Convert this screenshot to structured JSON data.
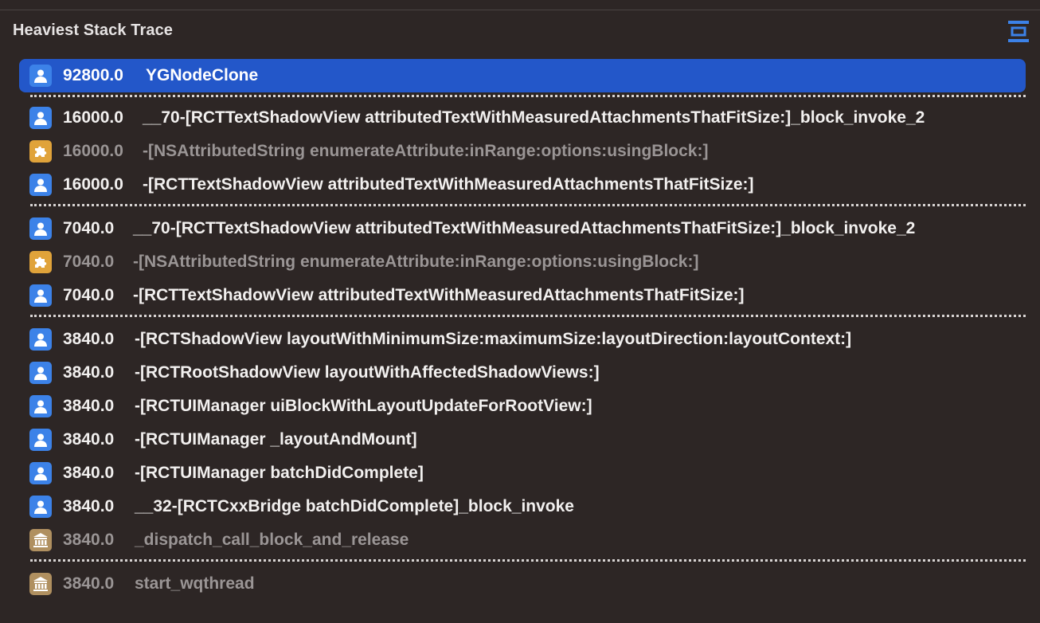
{
  "header": {
    "title": "Heaviest Stack Trace",
    "collapse_icon": "collapse-all-icon",
    "accent_color": "#3c82e8"
  },
  "colors": {
    "selection": "#2357c9",
    "user_icon": "#3c82e8",
    "framework_icon": "#e0a33a",
    "system_icon": "#b09060"
  },
  "frames": [
    {
      "weight": "92800.0",
      "symbol": "YGNodeClone",
      "icon": "user-icon",
      "selected": true
    },
    {
      "weight": "16000.0",
      "symbol": "__70-[RCTTextShadowView attributedTextWithMeasuredAttachmentsThatFitSize:]_block_invoke_2",
      "icon": "user-icon"
    },
    {
      "weight": "16000.0",
      "symbol": "-[NSAttributedString enumerateAttribute:inRange:options:usingBlock:]",
      "icon": "puzzle-icon"
    },
    {
      "weight": "16000.0",
      "symbol": "-[RCTTextShadowView attributedTextWithMeasuredAttachmentsThatFitSize:]",
      "icon": "user-icon"
    },
    {
      "weight": "7040.0",
      "symbol": "__70-[RCTTextShadowView attributedTextWithMeasuredAttachmentsThatFitSize:]_block_invoke_2",
      "icon": "user-icon"
    },
    {
      "weight": "7040.0",
      "symbol": "-[NSAttributedString enumerateAttribute:inRange:options:usingBlock:]",
      "icon": "puzzle-icon"
    },
    {
      "weight": "7040.0",
      "symbol": "-[RCTTextShadowView attributedTextWithMeasuredAttachmentsThatFitSize:]",
      "icon": "user-icon"
    },
    {
      "weight": "3840.0",
      "symbol": "-[RCTShadowView layoutWithMinimumSize:maximumSize:layoutDirection:layoutContext:]",
      "icon": "user-icon"
    },
    {
      "weight": "3840.0",
      "symbol": "-[RCTRootShadowView layoutWithAffectedShadowViews:]",
      "icon": "user-icon"
    },
    {
      "weight": "3840.0",
      "symbol": "-[RCTUIManager uiBlockWithLayoutUpdateForRootView:]",
      "icon": "user-icon"
    },
    {
      "weight": "3840.0",
      "symbol": "-[RCTUIManager _layoutAndMount]",
      "icon": "user-icon"
    },
    {
      "weight": "3840.0",
      "symbol": "-[RCTUIManager batchDidComplete]",
      "icon": "user-icon"
    },
    {
      "weight": "3840.0",
      "symbol": "__32-[RCTCxxBridge batchDidComplete]_block_invoke",
      "icon": "user-icon"
    },
    {
      "weight": "3840.0",
      "symbol": "_dispatch_call_block_and_release",
      "icon": "library-icon"
    },
    {
      "weight": "3840.0",
      "symbol": "start_wqthread",
      "icon": "library-icon"
    }
  ]
}
